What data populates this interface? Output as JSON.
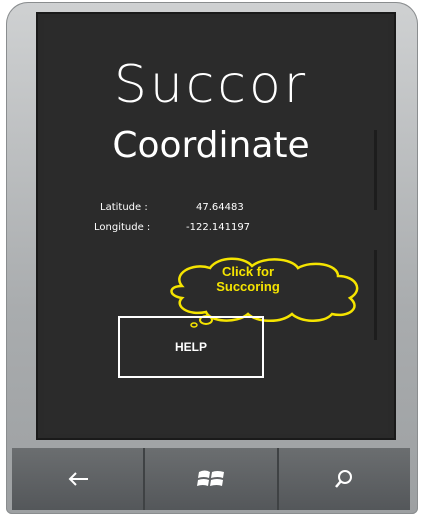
{
  "app": {
    "title": "Succor",
    "subtitle": "Coordinate"
  },
  "coordinates": {
    "latitude_label": "Latitude  :",
    "latitude_value": "47.64483",
    "longitude_label": "Longitude :",
    "longitude_value": "-122.141197"
  },
  "callout": {
    "line1": "Click for",
    "line2": "Succoring",
    "color": "#f5e400"
  },
  "help_button": {
    "label": "HELP"
  },
  "navbar": {
    "back_icon": "back-arrow-icon",
    "start_icon": "windows-logo-icon",
    "search_icon": "search-icon"
  }
}
